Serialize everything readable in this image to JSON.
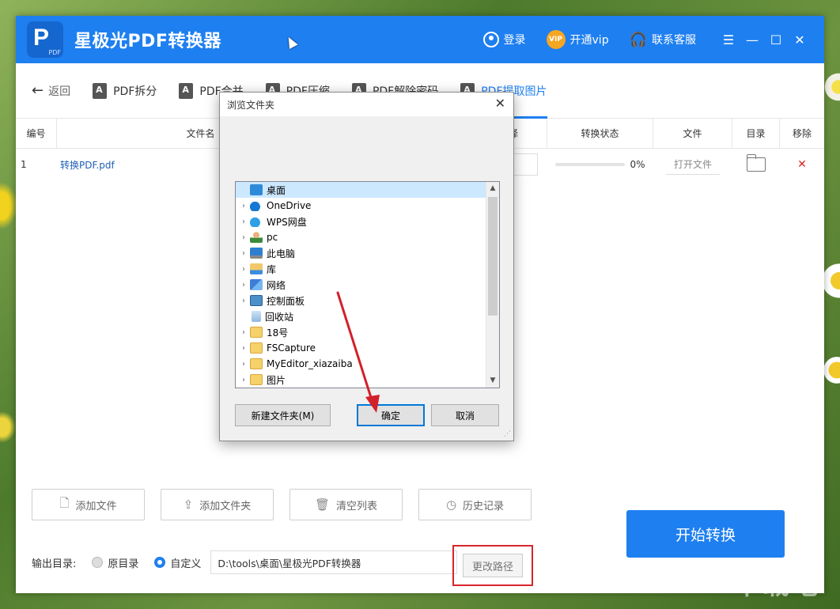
{
  "app": {
    "title": "星极光PDF转换器",
    "logo_letter": "P",
    "logo_sub": "PDF",
    "login_label": "登录",
    "vip_badge": "VIP",
    "vip_label": "开通vip",
    "support_label": "联系客服"
  },
  "tabs": {
    "back": "返回",
    "items": [
      "PDF拆分",
      "PDF合并",
      "PDF压缩",
      "PDF解除密码",
      "PDF提取图片"
    ],
    "active_index": 4
  },
  "table": {
    "headers": {
      "no": "编号",
      "name": "文件名",
      "mid": "择",
      "status": "转换状态",
      "file": "文件",
      "dir": "目录",
      "remove": "移除"
    },
    "rows": [
      {
        "no": "1",
        "name": "转换PDF.pdf",
        "progress": "0%",
        "open_label": "打开文件"
      }
    ]
  },
  "actions": {
    "add_file": "添加文件",
    "add_folder": "添加文件夹",
    "clear_list": "清空列表",
    "history": "历史记录",
    "start": "开始转换"
  },
  "output": {
    "label": "输出目录:",
    "opt_original": "原目录",
    "opt_custom": "自定义",
    "path": "D:\\tools\\桌面\\星极光PDF转换器",
    "change_label": "更改路径"
  },
  "dialog": {
    "title": "浏览文件夹",
    "tree": [
      {
        "label": "桌面",
        "icon": "desktop-icon",
        "selected": true,
        "expandable": false
      },
      {
        "label": "OneDrive",
        "icon": "onedrive-icon",
        "expandable": true
      },
      {
        "label": "WPS网盘",
        "icon": "wps-cloud-icon",
        "expandable": true
      },
      {
        "label": "pc",
        "icon": "user-icon",
        "expandable": true
      },
      {
        "label": "此电脑",
        "icon": "computer-icon",
        "expandable": true
      },
      {
        "label": "库",
        "icon": "library-icon",
        "expandable": true
      },
      {
        "label": "网络",
        "icon": "network-icon",
        "expandable": true
      },
      {
        "label": "控制面板",
        "icon": "control-panel-icon",
        "expandable": true
      },
      {
        "label": "回收站",
        "icon": "recycle-bin-icon",
        "expandable": false
      },
      {
        "label": "18号",
        "icon": "folder-icon",
        "expandable": true
      },
      {
        "label": "FSCapture",
        "icon": "folder-icon",
        "expandable": true
      },
      {
        "label": "MyEditor_xiazaiba",
        "icon": "folder-icon",
        "expandable": true
      },
      {
        "label": "图片",
        "icon": "folder-icon",
        "expandable": true
      }
    ],
    "new_folder": "新建文件夹(M)",
    "ok": "确定",
    "cancel": "取消"
  },
  "colors": {
    "primary": "#1e7ff0",
    "highlight": "#d9242b",
    "arrow": "#d3202a"
  }
}
